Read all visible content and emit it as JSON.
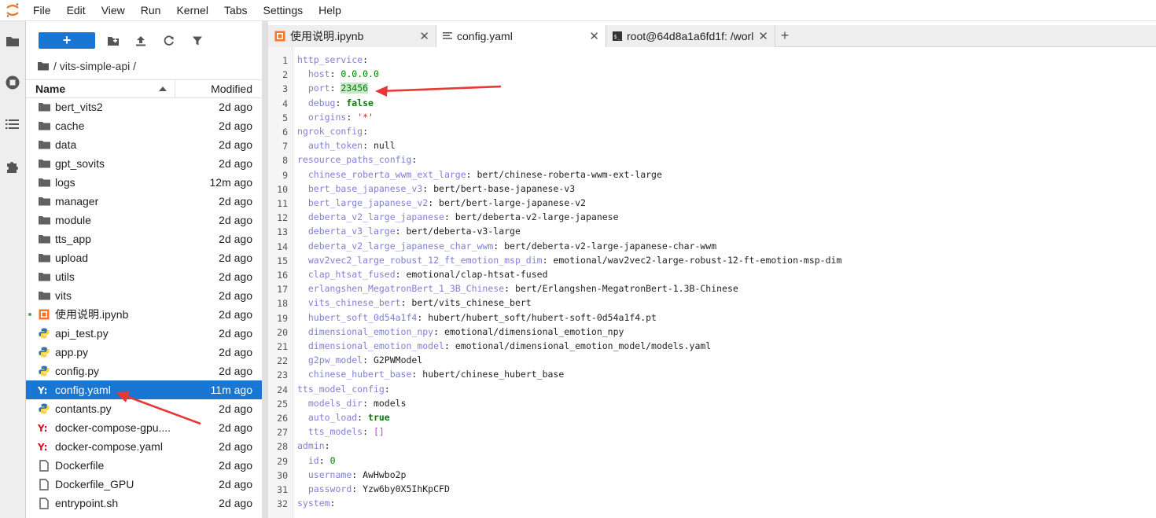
{
  "menubar": {
    "items": [
      "File",
      "Edit",
      "View",
      "Run",
      "Kernel",
      "Tabs",
      "Settings",
      "Help"
    ]
  },
  "filebrowser": {
    "new_label": "+",
    "breadcrumb": "/ vits-simple-api /",
    "header": {
      "name": "Name",
      "modified": "Modified"
    },
    "files": [
      {
        "name": "bert_vits2",
        "modified": "2d ago",
        "type": "folder"
      },
      {
        "name": "cache",
        "modified": "2d ago",
        "type": "folder"
      },
      {
        "name": "data",
        "modified": "2d ago",
        "type": "folder"
      },
      {
        "name": "gpt_sovits",
        "modified": "2d ago",
        "type": "folder"
      },
      {
        "name": "logs",
        "modified": "12m ago",
        "type": "folder"
      },
      {
        "name": "manager",
        "modified": "2d ago",
        "type": "folder"
      },
      {
        "name": "module",
        "modified": "2d ago",
        "type": "folder"
      },
      {
        "name": "tts_app",
        "modified": "2d ago",
        "type": "folder"
      },
      {
        "name": "upload",
        "modified": "2d ago",
        "type": "folder"
      },
      {
        "name": "utils",
        "modified": "2d ago",
        "type": "folder"
      },
      {
        "name": "vits",
        "modified": "2d ago",
        "type": "folder"
      },
      {
        "name": "使用说明.ipynb",
        "modified": "2d ago",
        "type": "notebook",
        "running": true
      },
      {
        "name": "api_test.py",
        "modified": "2d ago",
        "type": "python"
      },
      {
        "name": "app.py",
        "modified": "2d ago",
        "type": "python"
      },
      {
        "name": "config.py",
        "modified": "2d ago",
        "type": "python"
      },
      {
        "name": "config.yaml",
        "modified": "11m ago",
        "type": "yaml",
        "selected": true
      },
      {
        "name": "contants.py",
        "modified": "2d ago",
        "type": "python"
      },
      {
        "name": "docker-compose-gpu....",
        "modified": "2d ago",
        "type": "yaml"
      },
      {
        "name": "docker-compose.yaml",
        "modified": "2d ago",
        "type": "yaml"
      },
      {
        "name": "Dockerfile",
        "modified": "2d ago",
        "type": "file"
      },
      {
        "name": "Dockerfile_GPU",
        "modified": "2d ago",
        "type": "file"
      },
      {
        "name": "entrypoint.sh",
        "modified": "2d ago",
        "type": "file"
      }
    ]
  },
  "tabs": [
    {
      "label": "使用说明.ipynb",
      "icon": "notebook-icon",
      "active": false
    },
    {
      "label": "config.yaml",
      "icon": "text-file-icon",
      "active": true
    },
    {
      "label": "root@64d8a1a6fd1f: /worl",
      "icon": "terminal-icon",
      "active": false
    }
  ],
  "editor": {
    "lines": [
      [
        [
          "k",
          "http_service"
        ],
        [
          "v",
          ":"
        ]
      ],
      [
        [
          "v",
          "  "
        ],
        [
          "k",
          "host"
        ],
        [
          "v",
          ": "
        ],
        [
          "num",
          "0.0.0.0"
        ]
      ],
      [
        [
          "v",
          "  "
        ],
        [
          "k",
          "port"
        ],
        [
          "v",
          ": "
        ],
        [
          "numhl",
          "23456"
        ]
      ],
      [
        [
          "v",
          "  "
        ],
        [
          "k",
          "debug"
        ],
        [
          "v",
          ": "
        ],
        [
          "bool",
          "false"
        ]
      ],
      [
        [
          "v",
          "  "
        ],
        [
          "k",
          "origins"
        ],
        [
          "v",
          ": "
        ],
        [
          "str",
          "'*'"
        ]
      ],
      [
        [
          "k",
          "ngrok_config"
        ],
        [
          "v",
          ":"
        ]
      ],
      [
        [
          "v",
          "  "
        ],
        [
          "k",
          "auth_token"
        ],
        [
          "v",
          ": null"
        ]
      ],
      [
        [
          "k",
          "resource_paths_config"
        ],
        [
          "v",
          ":"
        ]
      ],
      [
        [
          "v",
          "  "
        ],
        [
          "k",
          "chinese_roberta_wwm_ext_large"
        ],
        [
          "v",
          ": bert/chinese-roberta-wwm-ext-large"
        ]
      ],
      [
        [
          "v",
          "  "
        ],
        [
          "k",
          "bert_base_japanese_v3"
        ],
        [
          "v",
          ": bert/bert-base-japanese-v3"
        ]
      ],
      [
        [
          "v",
          "  "
        ],
        [
          "k",
          "bert_large_japanese_v2"
        ],
        [
          "v",
          ": bert/bert-large-japanese-v2"
        ]
      ],
      [
        [
          "v",
          "  "
        ],
        [
          "k",
          "deberta_v2_large_japanese"
        ],
        [
          "v",
          ": bert/deberta-v2-large-japanese"
        ]
      ],
      [
        [
          "v",
          "  "
        ],
        [
          "k",
          "deberta_v3_large"
        ],
        [
          "v",
          ": bert/deberta-v3-large"
        ]
      ],
      [
        [
          "v",
          "  "
        ],
        [
          "k",
          "deberta_v2_large_japanese_char_wwm"
        ],
        [
          "v",
          ": bert/deberta-v2-large-japanese-char-wwm"
        ]
      ],
      [
        [
          "v",
          "  "
        ],
        [
          "k",
          "wav2vec2_large_robust_12_ft_emotion_msp_dim"
        ],
        [
          "v",
          ": emotional/wav2vec2-large-robust-12-ft-emotion-msp-dim"
        ]
      ],
      [
        [
          "v",
          "  "
        ],
        [
          "k",
          "clap_htsat_fused"
        ],
        [
          "v",
          ": emotional/clap-htsat-fused"
        ]
      ],
      [
        [
          "v",
          "  "
        ],
        [
          "k",
          "erlangshen_MegatronBert_1_3B_Chinese"
        ],
        [
          "v",
          ": bert/Erlangshen-MegatronBert-1.3B-Chinese"
        ]
      ],
      [
        [
          "v",
          "  "
        ],
        [
          "k",
          "vits_chinese_bert"
        ],
        [
          "v",
          ": bert/vits_chinese_bert"
        ]
      ],
      [
        [
          "v",
          "  "
        ],
        [
          "k",
          "hubert_soft_0d54a1f4"
        ],
        [
          "v",
          ": hubert/hubert_soft/hubert-soft-0d54a1f4.pt"
        ]
      ],
      [
        [
          "v",
          "  "
        ],
        [
          "k",
          "dimensional_emotion_npy"
        ],
        [
          "v",
          ": emotional/dimensional_emotion_npy"
        ]
      ],
      [
        [
          "v",
          "  "
        ],
        [
          "k",
          "dimensional_emotion_model"
        ],
        [
          "v",
          ": emotional/dimensional_emotion_model/models.yaml"
        ]
      ],
      [
        [
          "v",
          "  "
        ],
        [
          "k",
          "g2pw_model"
        ],
        [
          "v",
          ": G2PWModel"
        ]
      ],
      [
        [
          "v",
          "  "
        ],
        [
          "k",
          "chinese_hubert_base"
        ],
        [
          "v",
          ": hubert/chinese_hubert_base"
        ]
      ],
      [
        [
          "k",
          "tts_model_config"
        ],
        [
          "v",
          ":"
        ]
      ],
      [
        [
          "v",
          "  "
        ],
        [
          "k",
          "models_dir"
        ],
        [
          "v",
          ": models"
        ]
      ],
      [
        [
          "v",
          "  "
        ],
        [
          "k",
          "auto_load"
        ],
        [
          "v",
          ": "
        ],
        [
          "bool",
          "true"
        ]
      ],
      [
        [
          "v",
          "  "
        ],
        [
          "k",
          "tts_models"
        ],
        [
          "v",
          ": "
        ],
        [
          "brk",
          "[]"
        ]
      ],
      [
        [
          "k",
          "admin"
        ],
        [
          "v",
          ":"
        ]
      ],
      [
        [
          "v",
          "  "
        ],
        [
          "k",
          "id"
        ],
        [
          "v",
          ": "
        ],
        [
          "num",
          "0"
        ]
      ],
      [
        [
          "v",
          "  "
        ],
        [
          "k",
          "username"
        ],
        [
          "v",
          ": AwHwbo2p"
        ]
      ],
      [
        [
          "v",
          "  "
        ],
        [
          "k",
          "password"
        ],
        [
          "v",
          ": Yzw6by0X5IhKpCFD"
        ]
      ],
      [
        [
          "k",
          "system"
        ],
        [
          "v",
          ":"
        ]
      ]
    ]
  }
}
